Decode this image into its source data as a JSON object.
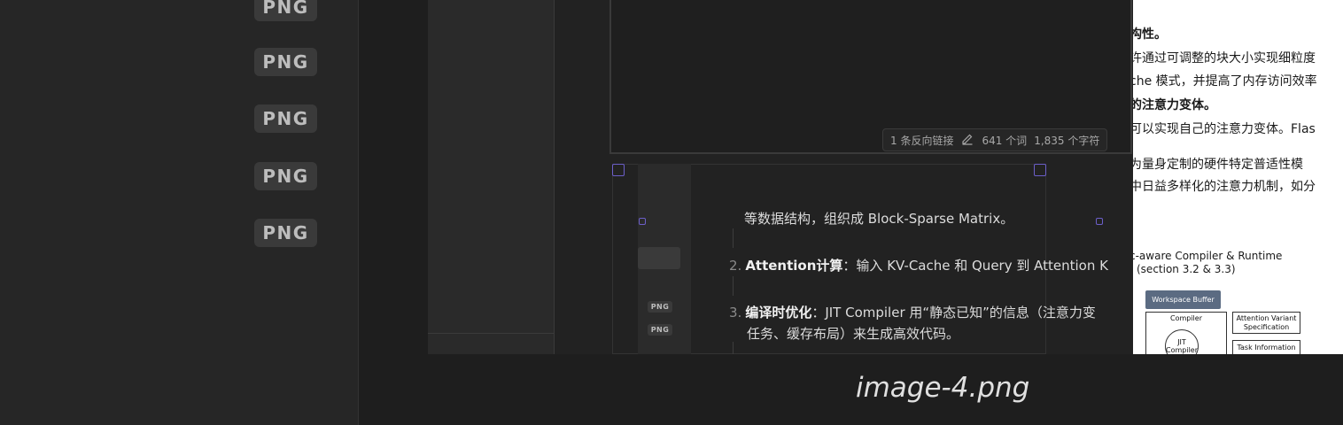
{
  "sidebar": {
    "badges": [
      {
        "label": "PNG"
      },
      {
        "label": "PNG"
      },
      {
        "label": "PNG"
      },
      {
        "label": "PNG"
      },
      {
        "label": "PNG"
      }
    ]
  },
  "preview": {
    "filename": "image-4.png"
  },
  "screenshot": {
    "status_bar": {
      "backlinks": "1 条反向链接",
      "words": "641 个词",
      "chars": "1,835 个字符"
    },
    "mini_badges": [
      {
        "label": "PNG"
      },
      {
        "label": "PNG"
      }
    ],
    "content": {
      "cut_line": "等数据结构，组织成 Block-Sparse Matrix。",
      "items": [
        {
          "num": "2.",
          "title": "Attention计算",
          "text": "：输入 KV-Cache 和 Query 到 Attention K"
        },
        {
          "num": "3.",
          "title": "编译时优化",
          "text": "：JIT Compiler 用“静态已知”的信息（注意力变"
        },
        {
          "num": "",
          "title": "",
          "text": "任务、缓存布局）来生成高效代码。"
        }
      ]
    },
    "doc": {
      "lines": [
        {
          "text": "构性。",
          "bold": true
        },
        {
          "text": "许通过可调整的块大小实现细粒度",
          "bold": false
        },
        {
          "text": "che 模式，并提高了内存访问效率",
          "bold": false
        },
        {
          "text": "的注意力变体。",
          "bold": true
        },
        {
          "text": "可以实现自己的注意力变体。Flas",
          "bold": false
        },
        {
          "text": "为量身定制的硬件特定普适性模",
          "bold": false
        },
        {
          "text": "中日益多样化的注意力机制，如分",
          "bold": false
        }
      ],
      "figure": {
        "title": "c-aware Compiler & Runtime",
        "subtitle": "(section 3.2 & 3.3)",
        "workspace": "Workspace Buffer",
        "compiler": "Compiler",
        "jit": "JIT Compiler",
        "attn_variant": "Attention Variant Specification",
        "task_info": "Task Information"
      }
    }
  }
}
